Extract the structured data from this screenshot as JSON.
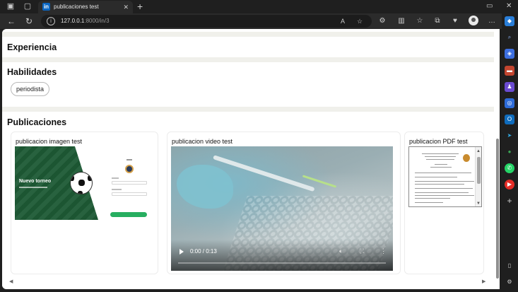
{
  "browser": {
    "tab_title": "publicaciones test",
    "tab_favicon": "in",
    "url_host": "127.0.0.1",
    "url_rest": ":8000/in/3",
    "icons": [
      "workspaces-icon",
      "tab-actions-icon",
      "close-tab-icon",
      "new-tab-icon",
      "minimize-icon",
      "close-window-icon",
      "back-icon",
      "refresh-icon",
      "site-info-icon",
      "read-aloud-icon",
      "favorite-icon",
      "extensions-icon",
      "split-screen-icon",
      "favorites-icon",
      "collections-icon",
      "browser-essentials-icon",
      "profile-icon",
      "more-icon"
    ]
  },
  "sidebar": {
    "icons": [
      "copilot-icon",
      "search-icon",
      "shopping-icon",
      "tools-icon",
      "games-icon",
      "microsoft365-icon",
      "outlook-icon",
      "telegram-icon",
      "tree-icon",
      "whatsapp-icon",
      "youtube-icon",
      "add-icon",
      "sidebar-toggle-icon",
      "settings-icon"
    ]
  },
  "page": {
    "experiencia_title": "Experiencia",
    "habilidades_title": "Habilidades",
    "skills": [
      "periodista"
    ],
    "publicaciones_title": "Publicaciones"
  },
  "posts": [
    {
      "title": "publicacion imagen test",
      "type": "image",
      "image_text": "Nuevo torneo"
    },
    {
      "title": "publicacion video test",
      "type": "video",
      "time": "0:00 / 0:13",
      "progress": 0.0
    },
    {
      "title": "publicacion PDF test",
      "type": "pdf"
    }
  ]
}
